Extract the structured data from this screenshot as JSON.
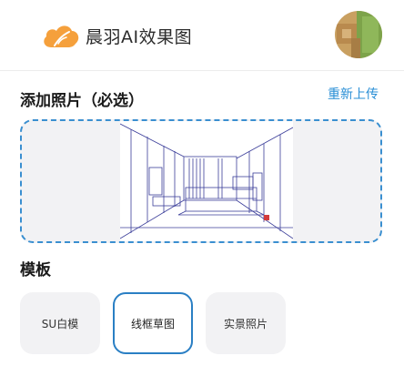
{
  "header": {
    "app_title": "晨羽AI效果图",
    "logo_icon": "cloud-feather-logo",
    "avatar_icon": "user-avatar"
  },
  "upload": {
    "title": "添加照片（必选）",
    "reupload_label": "重新上传",
    "preview_image": "line-sketch-bedroom-interior"
  },
  "templates": {
    "title": "模板",
    "items": [
      {
        "label": "SU白模",
        "selected": false
      },
      {
        "label": "线框草图",
        "selected": true
      },
      {
        "label": "实景照片",
        "selected": false
      }
    ]
  },
  "colors": {
    "accent": "#2a8fd6",
    "logo_orange": "#f5a03c",
    "panel_bg": "#f2f2f4"
  }
}
